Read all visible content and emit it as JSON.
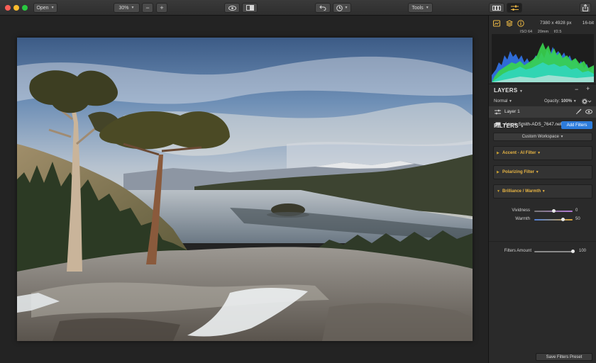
{
  "toolbar": {
    "open_label": "Open",
    "zoom_label": "30%",
    "zoom_out_label": "−",
    "zoom_in_label": "+",
    "tools_label": "Tools"
  },
  "panel": {
    "image_dims": "7380 x 4928 px",
    "bit_depth": "16-bit",
    "exif": {
      "iso": "ISO 64",
      "focal": "20mm",
      "aperture": "f/2.5"
    },
    "layers": {
      "title": "LAYERS",
      "add_label": "+",
      "remove_label": "−",
      "blend_mode": "Normal",
      "opacity_label": "Opacity:",
      "opacity_value": "100%",
      "layer_name": "Layer 1",
      "file_name": "Aaron-Smith-ADS_7647.nef"
    },
    "filters": {
      "title": "FILTERS",
      "add_button": "Add Filters",
      "workspace": "Custom Workspace",
      "items": [
        {
          "name": "Accent - AI Filter",
          "expanded": false
        },
        {
          "name": "Polarizing Filter",
          "expanded": false
        },
        {
          "name": "Brilliance / Warmth",
          "expanded": true
        }
      ],
      "brilliance": {
        "vividness_label": "Vividness",
        "vividness_value": "0",
        "vividness_level": 0.5,
        "warmth_label": "Warmth",
        "warmth_value": "50",
        "warmth_level": 0.75
      },
      "amount_label": "Filters Amount",
      "amount_value": "100",
      "amount_level": 1.0
    },
    "save_preset": "Save Filters Preset"
  },
  "colors": {
    "accent_blue": "#2d7cdb",
    "filter_gold": "#e8b544",
    "panel_bg": "#2a2a2a",
    "canvas_bg": "#232323"
  }
}
